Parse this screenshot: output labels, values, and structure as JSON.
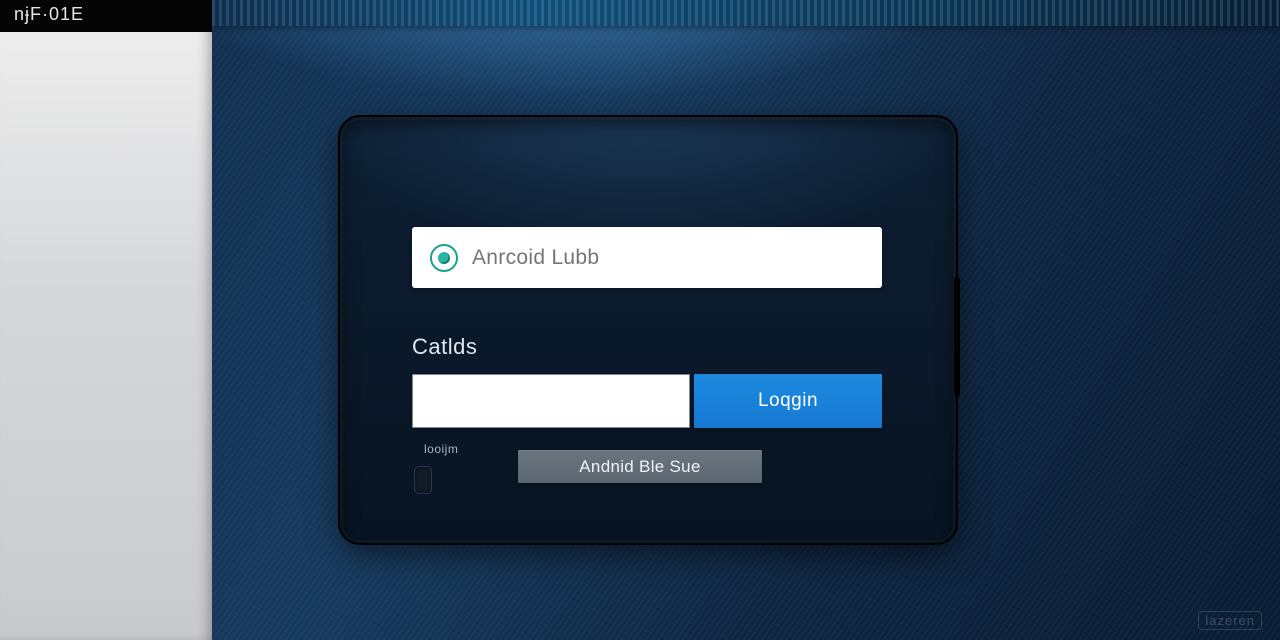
{
  "brand": {
    "logo_text": "nɉF·01E"
  },
  "form": {
    "username": {
      "placeholder": "Anrcoid Lubb",
      "value": ""
    },
    "section_label": "Catlds",
    "password": {
      "value": ""
    },
    "login_button": "Loqgin",
    "mini_label": "looijm",
    "secondary_button": "Andnid Ble Sue"
  },
  "footer": {
    "watermark": "lazeren"
  },
  "colors": {
    "accent_blue": "#1678d2",
    "accent_teal": "#1aa18f",
    "panel_bg": "#0a1829"
  }
}
